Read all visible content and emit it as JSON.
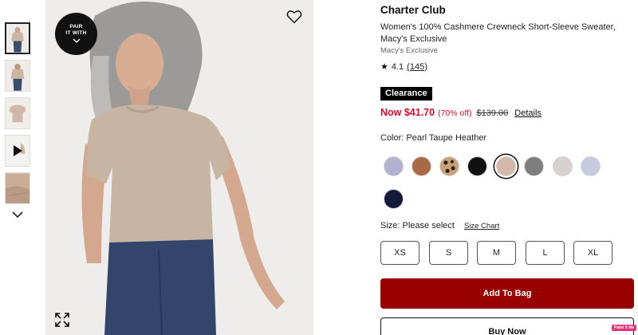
{
  "product": {
    "brand": "Charter Club",
    "title": "Women's 100% Cashmere Crewneck Short-Sleeve Sweater, Macy's Exclusive",
    "exclusive_label": "Macy's Exclusive",
    "rating": "4.1",
    "review_count": "(145)"
  },
  "badge": {
    "line1": "PAIR",
    "line2": "IT WITH"
  },
  "pricing": {
    "tag": "Clearance",
    "now": "Now $41.70",
    "percent_off": "(70% off)",
    "original": "$139.00",
    "details_link": "Details",
    "sale_color": "#c8102e"
  },
  "color": {
    "label": "Color: Pearl Taupe Heather",
    "swatches": [
      {
        "name": "lavender",
        "hex": "#b3b0d0"
      },
      {
        "name": "camel",
        "hex": "#a86a45"
      },
      {
        "name": "leopard",
        "hex": "#8a6a4a"
      },
      {
        "name": "black",
        "hex": "#111111"
      },
      {
        "name": "pearl-taupe-heather",
        "hex": "#d4b8ac",
        "selected": true
      },
      {
        "name": "grey-heather",
        "hex": "#7e7e7e"
      },
      {
        "name": "oatmeal",
        "hex": "#d9d1cf"
      },
      {
        "name": "light-blue",
        "hex": "#c6cbe2"
      },
      {
        "name": "navy",
        "hex": "#15193a"
      }
    ]
  },
  "size": {
    "label": "Size: Please select",
    "chart_link": "Size Chart",
    "options": [
      "XS",
      "S",
      "M",
      "L",
      "XL"
    ]
  },
  "actions": {
    "add_to_bag": "Add To Bag",
    "buy_now": "Buy Now",
    "brand_color": "#990000"
  },
  "overlay": {
    "paint_label": "Paint X Me"
  },
  "icons": {
    "heart": "heart-icon",
    "expand": "expand-icon",
    "chevron": "chevron-down-icon",
    "play": "play-icon",
    "star": "star-icon"
  }
}
